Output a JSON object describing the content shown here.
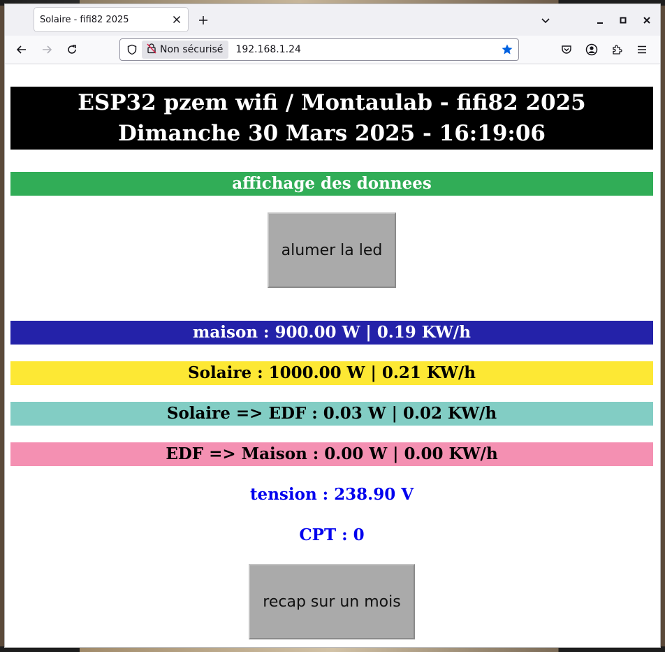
{
  "browser": {
    "tab_title": "Solaire - fifi82 2025",
    "security_label": "Non sécurisé",
    "url": "192.168.1.24"
  },
  "page": {
    "header_line1": "ESP32 pzem wifi / Montaulab - fifi82 2025",
    "header_line2": "Dimanche 30 Mars 2025 - 16:19:06",
    "section_title": "affichage des donnees",
    "led_button": "alumer la led",
    "maison": "maison : 900.00 W | 0.19 KW/h",
    "solaire": "Solaire : 1000.00 W | 0.21 KW/h",
    "solaire_edf": "Solaire => EDF : 0.03 W | 0.02 KW/h",
    "edf_maison": "EDF => Maison : 0.00 W | 0.00 KW/h",
    "tension": "tension : 238.90 V",
    "cpt": "CPT : 0",
    "recap_button": "recap sur un mois"
  },
  "colors": {
    "header_bg": "#000000",
    "section_bg": "#31ad57",
    "maison_bg": "#2422a9",
    "solaire_bg": "#fde834",
    "solaire_edf_bg": "#82cdc4",
    "edf_maison_bg": "#f490b2",
    "info_text": "#0000ee",
    "button_bg": "#aaaaaa"
  },
  "icons": {
    "back": "arrow-left-icon",
    "forward": "arrow-right-icon",
    "reload": "reload-icon",
    "shield": "shield-icon",
    "not_secure": "lock-slash-icon",
    "bookmark": "star-icon",
    "pocket": "pocket-icon",
    "account": "account-icon",
    "extensions": "puzzle-icon",
    "menu": "hamburger-menu-icon"
  }
}
